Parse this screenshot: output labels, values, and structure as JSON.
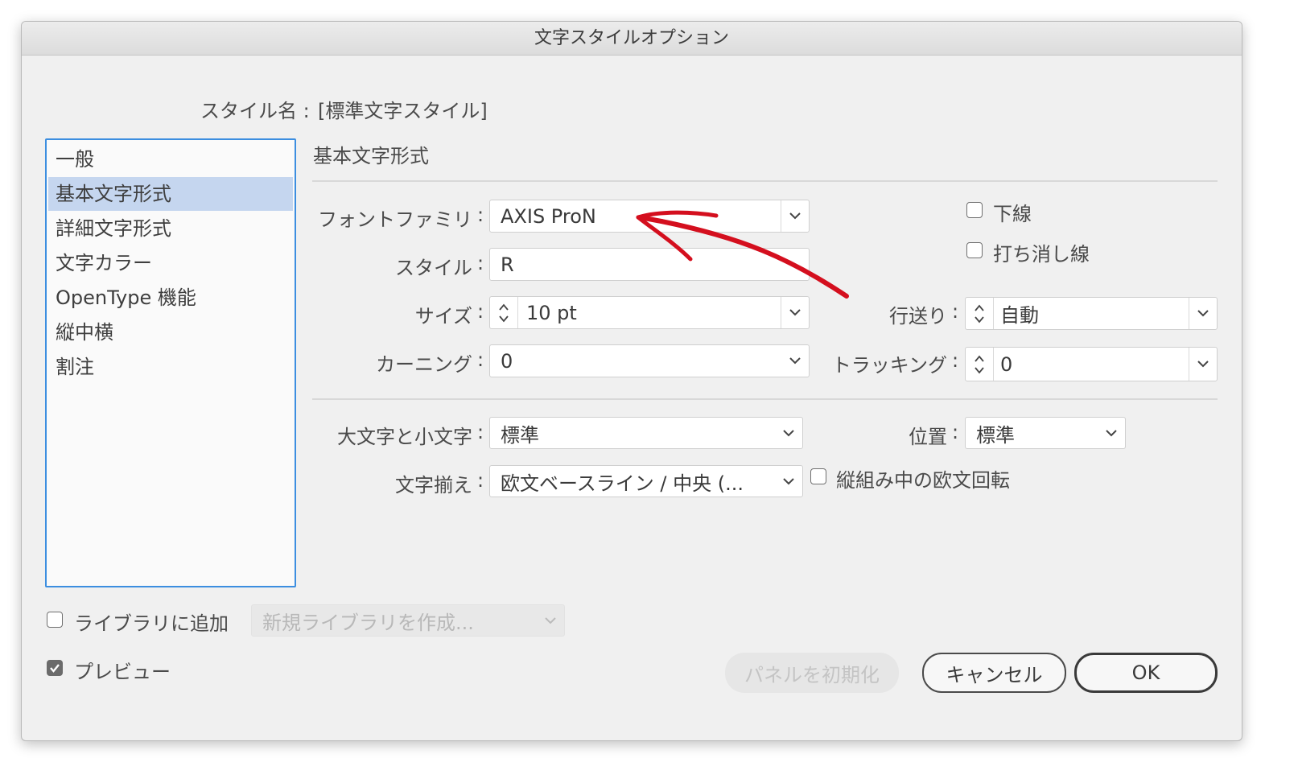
{
  "window": {
    "title": "文字スタイルオプション"
  },
  "style_name": {
    "label": "スタイル名 :",
    "value": "[標準文字スタイル]"
  },
  "sidebar": {
    "items": [
      {
        "label": "一般"
      },
      {
        "label": "基本文字形式",
        "selected": true
      },
      {
        "label": "詳細文字形式"
      },
      {
        "label": "文字カラー"
      },
      {
        "label": "OpenType 機能"
      },
      {
        "label": "縦中横"
      },
      {
        "label": "割注"
      }
    ]
  },
  "section": {
    "title": "基本文字形式"
  },
  "form": {
    "font_family": {
      "label": "フォントファミリ",
      "value": "AXIS ProN"
    },
    "font_style": {
      "label": "スタイル",
      "value": "R"
    },
    "size": {
      "label": "サイズ",
      "value": "10 pt"
    },
    "kerning": {
      "label": "カーニング",
      "value": "0"
    },
    "leading": {
      "label": "行送り",
      "value": "自動"
    },
    "tracking": {
      "label": "トラッキング",
      "value": "0"
    },
    "underline": {
      "label": "下線",
      "checked": false
    },
    "strikethrough": {
      "label": "打ち消し線",
      "checked": false
    },
    "case": {
      "label": "大文字と小文字",
      "value": "標準"
    },
    "position": {
      "label": "位置",
      "value": "標準"
    },
    "alignment": {
      "label": "文字揃え",
      "value": "欧文ベースライン / 中央 (..."
    },
    "rotate_roman": {
      "label": "縦組み中の欧文回転",
      "checked": false
    },
    "colon": ":"
  },
  "footer": {
    "add_to_library": {
      "label": "ライブラリに追加",
      "checked": false
    },
    "library_select": {
      "value": "新規ライブラリを作成..."
    },
    "preview": {
      "label": "プレビュー",
      "checked": true
    },
    "reset_label": "パネルを初期化",
    "cancel_label": "キャンセル",
    "ok_label": "OK"
  },
  "colors": {
    "accent": "#3c8ee0",
    "selection": "#c5d6ef",
    "annotation": "#d40f1e"
  },
  "icons": [
    "chevron-down-icon",
    "stepper-icon",
    "checkmark-icon",
    "arrow-annotation"
  ]
}
